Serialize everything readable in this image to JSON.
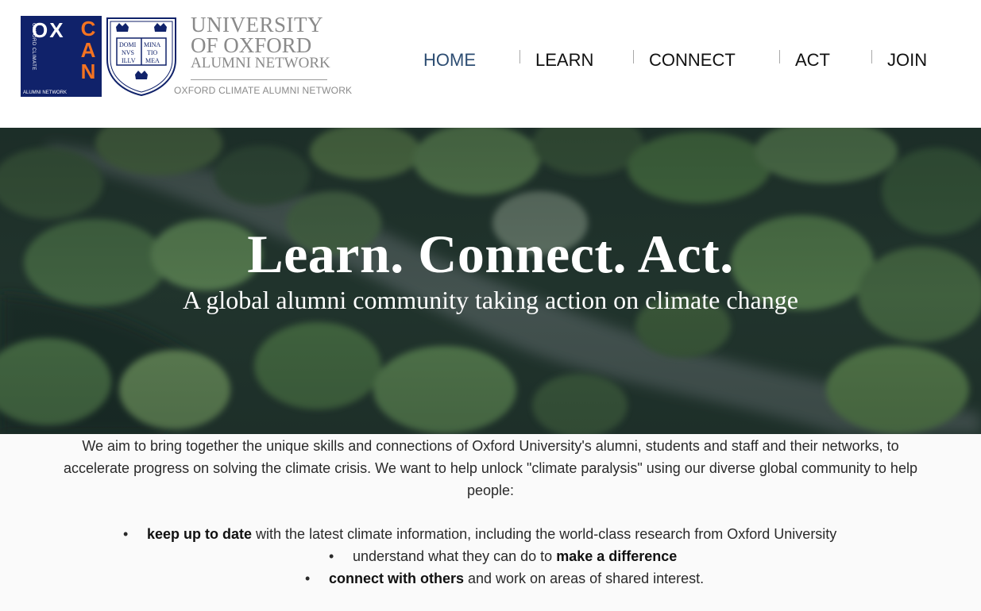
{
  "logo": {
    "oxcan_ox": "OX",
    "oxcan_can_letters": [
      "C",
      "A",
      "N"
    ],
    "oxcan_side": "OXFORD CLIMATE",
    "oxcan_foot": "ALUMNI NETWORK",
    "crest_book_left": [
      "DOMI",
      "NVS",
      "ILLV"
    ],
    "crest_book_right": [
      "MINA",
      "TIO",
      "MEA"
    ],
    "university_line1": "UNIVERSITY",
    "university_line2": "OF OXFORD",
    "university_line3": "ALUMNI NETWORK",
    "network_name": "OXFORD CLIMATE ALUMNI NETWORK",
    "brand_navy": "#10226a",
    "brand_orange": "#f47321"
  },
  "nav": {
    "items": [
      {
        "label": "HOME"
      },
      {
        "label": "LEARN"
      },
      {
        "label": "CONNECT"
      },
      {
        "label": "ACT"
      },
      {
        "label": "JOIN"
      }
    ],
    "active": "HOME",
    "active_color": "#2d4d72"
  },
  "hero": {
    "title": "Learn. Connect. Act.",
    "subtitle": "A global alumni community taking action on climate change"
  },
  "intro": {
    "text": "We aim to bring together the unique skills and connections of Oxford University's alumni, students and staff and their networks, to accelerate progress on solving the climate crisis. We want to help unlock \"climate paralysis\" using our diverse global community to help people:"
  },
  "bullets": [
    {
      "bold": "keep up to date",
      "after": " with the latest climate information, including the world-class research from Oxford University"
    },
    {
      "before": "understand what they can do to ",
      "bold": "make a difference"
    },
    {
      "bold": "connect with others",
      "after": " and work on areas of shared interest."
    }
  ]
}
